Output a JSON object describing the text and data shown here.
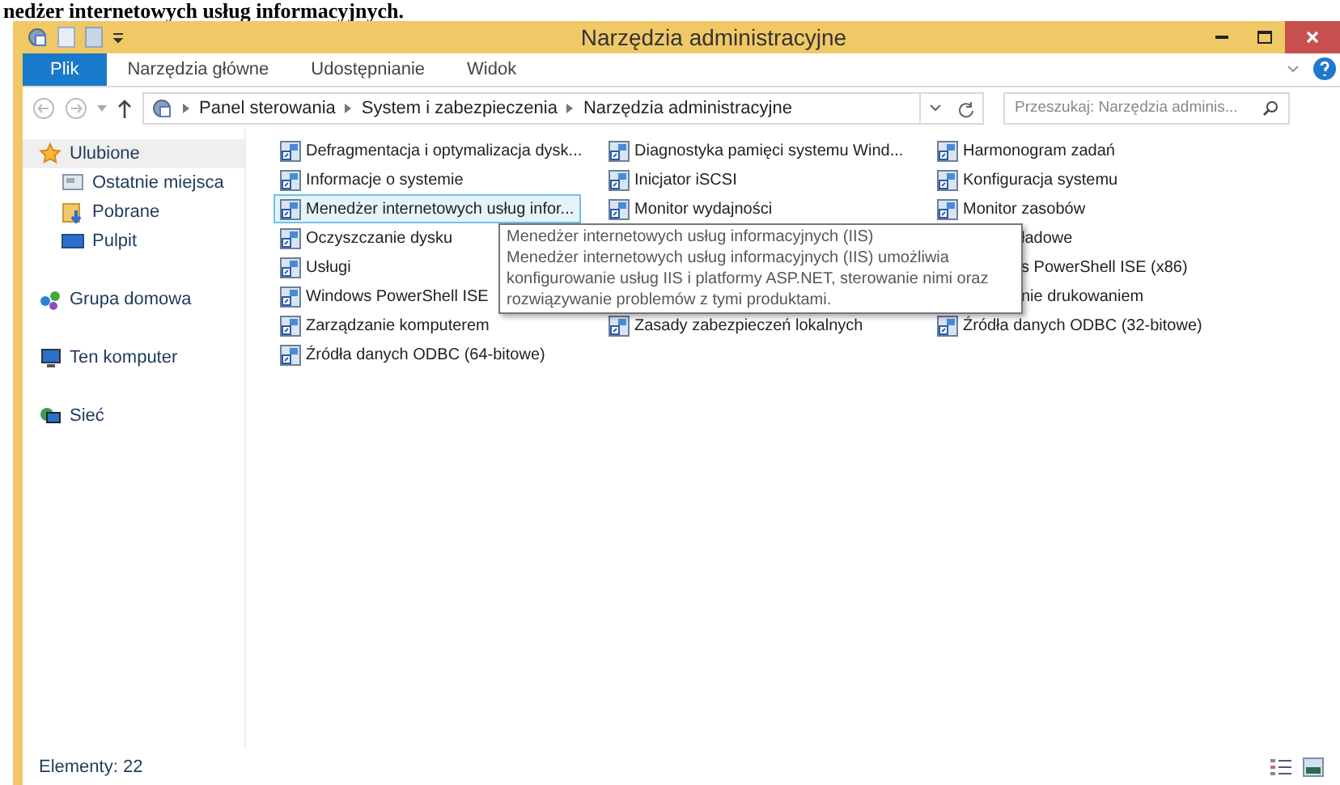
{
  "caption": "nedżer internetowych usług informacyjnych.",
  "window": {
    "title": "Narzędzia administracyjne"
  },
  "ribbon_tabs": [
    {
      "label": "Plik",
      "selected": true
    },
    {
      "label": "Narzędzia główne",
      "selected": false
    },
    {
      "label": "Udostępnianie",
      "selected": false
    },
    {
      "label": "Widok",
      "selected": false
    }
  ],
  "breadcrumb": [
    "Panel sterowania",
    "System i zabezpieczenia",
    "Narzędzia administracyjne"
  ],
  "search": {
    "placeholder": "Przeszukaj: Narzędzia adminis..."
  },
  "sidebar": {
    "items": [
      {
        "label": "Ulubione",
        "kind": "star",
        "selected": true,
        "children": [
          {
            "label": "Ostatnie miejsca",
            "kind": "recent",
            "selected": false
          },
          {
            "label": "Pobrane",
            "kind": "download",
            "selected": false
          },
          {
            "label": "Pulpit",
            "kind": "desktop",
            "selected": false
          }
        ]
      },
      {
        "label": "Grupa domowa",
        "kind": "homegroup",
        "selected": false
      },
      {
        "label": "Ten komputer",
        "kind": "computer",
        "selected": false
      },
      {
        "label": "Sieć",
        "kind": "network",
        "selected": false
      }
    ]
  },
  "columns": [
    [
      {
        "label": "Defragmentacja i optymalizacja dysk...",
        "selected": false
      },
      {
        "label": "Informacje o systemie",
        "selected": false
      },
      {
        "label": "Menedżer internetowych usług infor...",
        "selected": true
      },
      {
        "label": "Oczyszczanie dysku",
        "selected": false
      },
      {
        "label": "Usługi",
        "selected": false
      },
      {
        "label": "Windows PowerShell ISE",
        "selected": false
      },
      {
        "label": "Zarządzanie komputerem",
        "selected": false
      },
      {
        "label": "Źródła danych ODBC (64-bitowe)",
        "selected": false
      }
    ],
    [
      {
        "label": "Diagnostyka pamięci systemu Wind...",
        "selected": false
      },
      {
        "label": "Inicjator iSCSI",
        "selected": false
      },
      {
        "label": "Monitor wydajności",
        "selected": false
      },
      {
        "kind": "hidden"
      },
      {
        "kind": "hidden"
      },
      {
        "kind": "hidden"
      },
      {
        "label": "Zasady zabezpieczeń lokalnych",
        "selected": false
      }
    ],
    [
      {
        "label": "Harmonogram zadań",
        "selected": false
      },
      {
        "label": "Konfiguracja systemu",
        "selected": false
      },
      {
        "label": "Monitor zasobów",
        "selected": false
      },
      {
        "label": "ładowe",
        "kind": "partial"
      },
      {
        "label": "s PowerShell ISE (x86)",
        "kind": "partial"
      },
      {
        "label": "nie drukowaniem",
        "kind": "partial"
      },
      {
        "label": "Źródła danych ODBC (32-bitowe)",
        "selected": false
      }
    ]
  ],
  "tooltip": {
    "title": "Menedżer internetowych usług informacyjnych (IIS)",
    "body": "Menedżer internetowych usług informacyjnych (IIS) umożliwia konfigurowanie usług IIS i platformy ASP.NET, sterowanie nimi oraz rozwiązywanie problemów z tymi produktami."
  },
  "status_bar": {
    "count": "Elementy: 22"
  }
}
